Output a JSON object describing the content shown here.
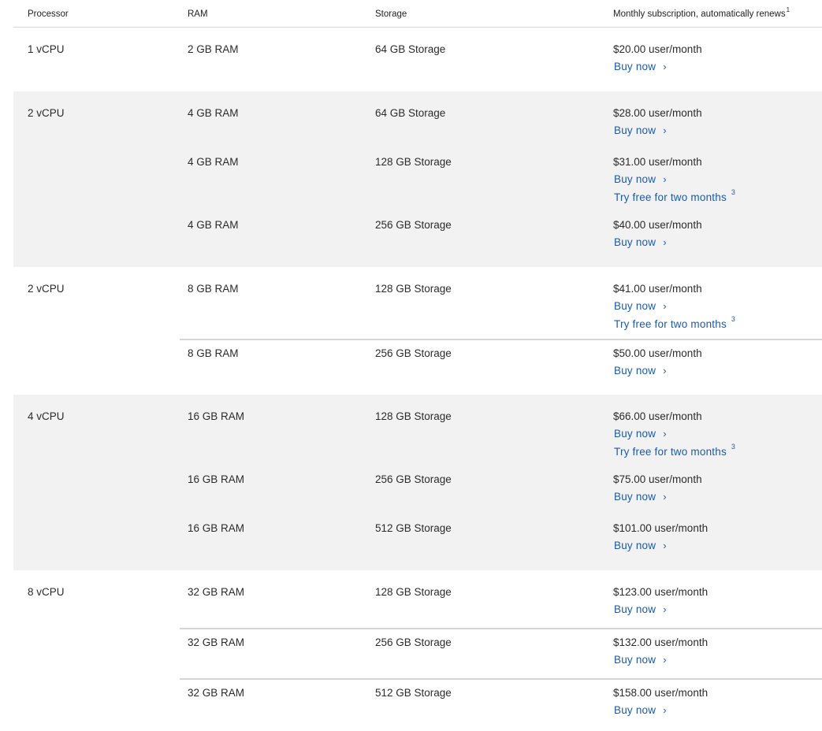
{
  "header": {
    "processor": "Processor",
    "ram": "RAM",
    "storage": "Storage",
    "price": "Monthly subscription, automatically renews",
    "price_footnote": "1"
  },
  "labels": {
    "buy_now": "Buy now",
    "try_free": "Try free for two months",
    "try_free_footnote": "3",
    "chevron": "›"
  },
  "groups": [
    {
      "processor": "1 vCPU",
      "rows": [
        {
          "ram": "2 GB RAM",
          "storage": "64 GB Storage",
          "price": "$20.00 user/month"
        }
      ]
    },
    {
      "processor": "2 vCPU",
      "rows": [
        {
          "ram": "4 GB RAM",
          "storage": "64 GB Storage",
          "price": "$28.00 user/month"
        },
        {
          "ram": "4 GB RAM",
          "storage": "128 GB Storage",
          "price": "$31.00 user/month",
          "trial": true
        },
        {
          "ram": "4 GB RAM",
          "storage": "256 GB Storage",
          "price": "$40.00 user/month"
        }
      ]
    },
    {
      "processor": "2 vCPU",
      "rows": [
        {
          "ram": "8 GB RAM",
          "storage": "128 GB Storage",
          "price": "$41.00 user/month",
          "trial": true
        },
        {
          "ram": "8 GB RAM",
          "storage": "256 GB Storage",
          "price": "$50.00 user/month"
        }
      ]
    },
    {
      "processor": "4 vCPU",
      "rows": [
        {
          "ram": "16 GB RAM",
          "storage": "128 GB Storage",
          "price": "$66.00 user/month",
          "trial": true
        },
        {
          "ram": "16 GB RAM",
          "storage": "256 GB Storage",
          "price": "$75.00 user/month"
        },
        {
          "ram": "16 GB RAM",
          "storage": "512 GB Storage",
          "price": "$101.00 user/month"
        }
      ]
    },
    {
      "processor": "8 vCPU",
      "rows": [
        {
          "ram": "32 GB RAM",
          "storage": "128 GB Storage",
          "price": "$123.00 user/month"
        },
        {
          "ram": "32 GB RAM",
          "storage": "256 GB Storage",
          "price": "$132.00 user/month"
        },
        {
          "ram": "32 GB RAM",
          "storage": "512 GB Storage",
          "price": "$158.00 user/month"
        }
      ]
    }
  ]
}
